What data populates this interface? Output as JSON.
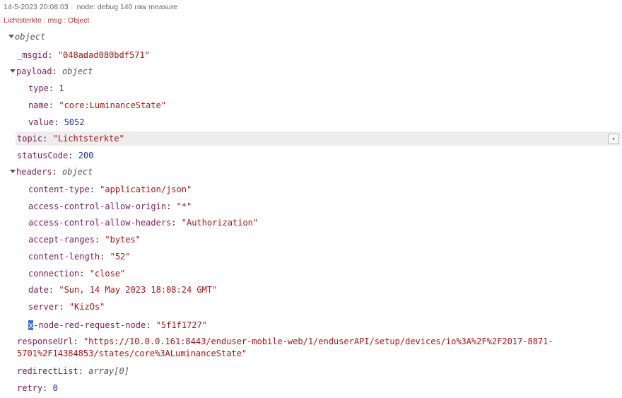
{
  "header": {
    "timestamp": "14-5-2023 20:08:03",
    "node": "node: debug 140 raw measure"
  },
  "subheader": "Lichtsterkte : msg : Object",
  "tree": {
    "root_type": "object",
    "msgid": {
      "key": "_msgid",
      "value": "\"048adad080bdf571\""
    },
    "payload": {
      "key": "payload",
      "type": "object",
      "type_field": {
        "key": "type",
        "value": "1"
      },
      "name_field": {
        "key": "name",
        "value": "\"core:LuminanceState\""
      },
      "value_field": {
        "key": "value",
        "value": "5052"
      }
    },
    "topic": {
      "key": "topic",
      "value": "\"Lichtsterkte\""
    },
    "statusCode": {
      "key": "statusCode",
      "value": "200"
    },
    "headers": {
      "key": "headers",
      "type": "object",
      "content_type": {
        "key": "content-type",
        "value": "\"application/json\""
      },
      "acao": {
        "key": "access-control-allow-origin",
        "value": "\"*\""
      },
      "acah": {
        "key": "access-control-allow-headers",
        "value": "\"Authorization\""
      },
      "accept_ranges": {
        "key": "accept-ranges",
        "value": "\"bytes\""
      },
      "content_length": {
        "key": "content-length",
        "value": "\"52\""
      },
      "connection": {
        "key": "connection",
        "value": "\"close\""
      },
      "date": {
        "key": "date",
        "value": "\"Sun, 14 May 2023 18:08:24 GMT\""
      },
      "server": {
        "key": "server",
        "value": "\"KizOs\""
      },
      "x_node": {
        "key_first": "x",
        "key_rest": "-node-red-request-node",
        "value": "\"5f1f1727\""
      }
    },
    "responseUrl": {
      "key": "responseUrl",
      "line1": "\"https://10.0.0.161:8443/enduser-mobile-web/1/enduserAPI/setup/devices/io%3A%2F%2F2017-8871-",
      "line2": "5701%2F14384853/states/core%3ALuminanceState\""
    },
    "redirectList": {
      "key": "redirectList",
      "value": "array[0]"
    },
    "retry": {
      "key": "retry",
      "value": "0"
    }
  },
  "pin_icon": "pin-icon"
}
